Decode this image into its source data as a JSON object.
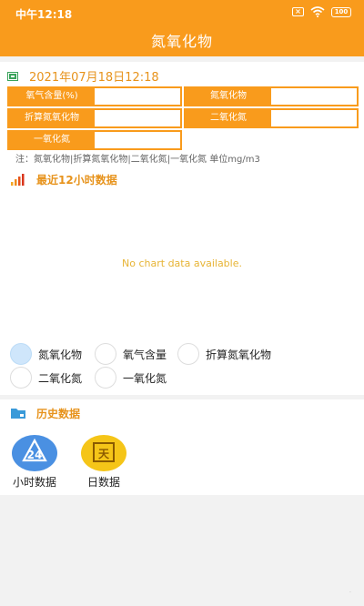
{
  "status": {
    "time": "中午12:18",
    "battery": "100"
  },
  "app": {
    "title": "氮氧化物"
  },
  "reading": {
    "datetime": "2021年07月18日12:18",
    "fields": [
      {
        "label": "氧气含量(%)",
        "value": ""
      },
      {
        "label": "氮氧化物",
        "value": ""
      },
      {
        "label": "折算氮氧化物",
        "value": ""
      },
      {
        "label": "二氧化氮",
        "value": ""
      },
      {
        "label": "一氧化氮",
        "value": ""
      }
    ],
    "note": "注：氮氧化物|折算氮氧化物|二氧化氮|一氧化氮 单位mg/m3"
  },
  "recent": {
    "title": "最近12小时数据",
    "no_data": "No chart data available."
  },
  "series_options": [
    {
      "label": "氮氧化物",
      "selected": true
    },
    {
      "label": "氧气含量",
      "selected": false
    },
    {
      "label": "折算氮氧化物",
      "selected": false
    },
    {
      "label": "二氧化氮",
      "selected": false
    },
    {
      "label": "一氧化氮",
      "selected": false
    }
  ],
  "history": {
    "title": "历史数据",
    "hourly_icon_text": "24",
    "hourly_label": "小时数据",
    "daily_icon_text": "天",
    "daily_label": "日数据"
  },
  "colors": {
    "accent": "#f99b1c",
    "text_accent": "#e7931c",
    "blue": "#4a90e2",
    "yellow": "#f5c518"
  }
}
